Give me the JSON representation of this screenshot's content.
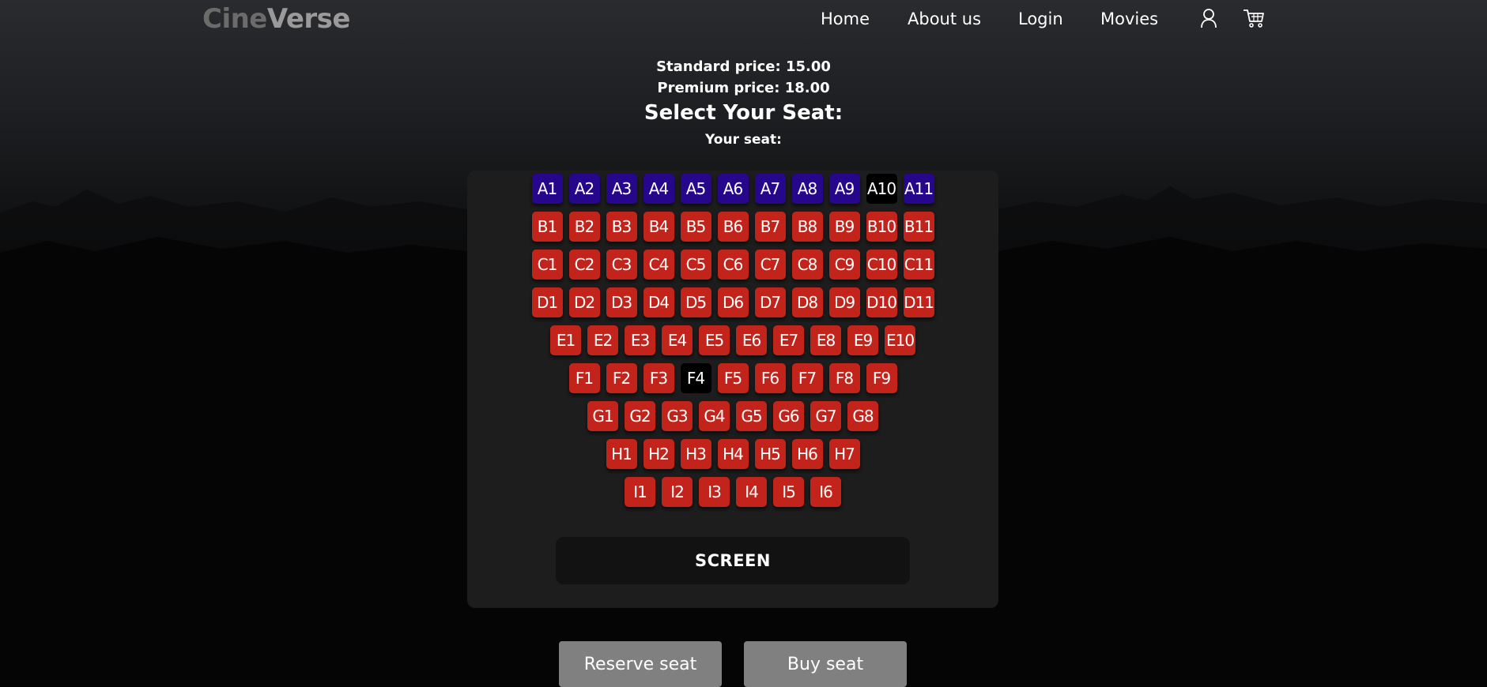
{
  "brand": {
    "part1": "Cine",
    "part2": "Verse"
  },
  "nav": {
    "home": "Home",
    "about": "About us",
    "login": "Login",
    "movies": "Movies",
    "icons": [
      "user-icon",
      "cart-icon"
    ]
  },
  "pricing": {
    "standard": "Standard price: 15.00",
    "premium": "Premium price: 18.00"
  },
  "heading": "Select Your Seat:",
  "your_seat_label": "Your seat:",
  "colors": {
    "standard_seat": "#c2241b",
    "premium_seat": "#26068a",
    "taken_seat": "#000000"
  },
  "seat_rows": [
    {
      "seats": [
        "A1",
        "A2",
        "A3",
        "A4",
        "A5",
        "A6",
        "A7",
        "A8",
        "A9",
        "A10",
        "A11"
      ],
      "type": "premium",
      "taken": [
        "A10"
      ]
    },
    {
      "seats": [
        "B1",
        "B2",
        "B3",
        "B4",
        "B5",
        "B6",
        "B7",
        "B8",
        "B9",
        "B10",
        "B11"
      ],
      "type": "standard",
      "taken": []
    },
    {
      "seats": [
        "C1",
        "C2",
        "C3",
        "C4",
        "C5",
        "C6",
        "C7",
        "C8",
        "C9",
        "C10",
        "C11"
      ],
      "type": "standard",
      "taken": []
    },
    {
      "seats": [
        "D1",
        "D2",
        "D3",
        "D4",
        "D5",
        "D6",
        "D7",
        "D8",
        "D9",
        "D10",
        "D11"
      ],
      "type": "standard",
      "taken": []
    },
    {
      "seats": [
        "E1",
        "E2",
        "E3",
        "E4",
        "E5",
        "E6",
        "E7",
        "E8",
        "E9",
        "E10"
      ],
      "type": "standard",
      "taken": []
    },
    {
      "seats": [
        "F1",
        "F2",
        "F3",
        "F4",
        "F5",
        "F6",
        "F7",
        "F8",
        "F9"
      ],
      "type": "standard",
      "taken": [
        "F4"
      ]
    },
    {
      "seats": [
        "G1",
        "G2",
        "G3",
        "G4",
        "G5",
        "G6",
        "G7",
        "G8"
      ],
      "type": "standard",
      "taken": []
    },
    {
      "seats": [
        "H1",
        "H2",
        "H3",
        "H4",
        "H5",
        "H6",
        "H7"
      ],
      "type": "standard",
      "taken": []
    },
    {
      "seats": [
        "I1",
        "I2",
        "I3",
        "I4",
        "I5",
        "I6"
      ],
      "type": "standard",
      "taken": []
    }
  ],
  "screen_label": "SCREEN",
  "buttons": {
    "reserve": "Reserve seat",
    "buy": "Buy seat"
  }
}
